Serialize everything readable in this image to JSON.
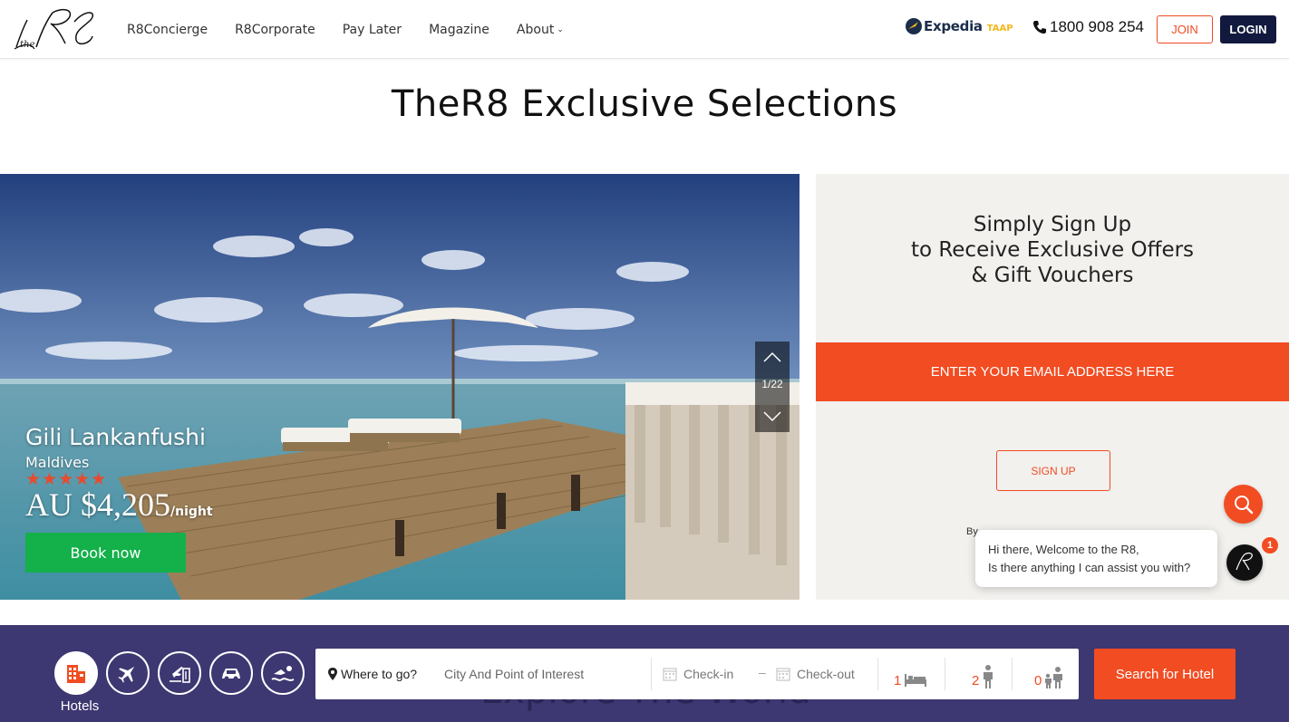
{
  "header": {
    "nav": [
      "R8Concierge",
      "R8Corporate",
      "Pay Later",
      "Magazine",
      "About"
    ],
    "expedia": {
      "name": "Expedia",
      "suffix": "TAAP"
    },
    "phone": "1800 908 254",
    "join_label": "JOIN",
    "login_label": "LOGIN"
  },
  "page_title": "TheR8 Exclusive Selections",
  "featured": {
    "hotel_name": "Gili Lankanfushi",
    "location": "Maldives",
    "stars": "★★★★★",
    "price": "AU $4,205",
    "price_unit": "/night",
    "book_label": "Book now",
    "slide_counter": "1/22"
  },
  "signup": {
    "title_lines": [
      "Simply Sign Up",
      "to Receive Exclusive Offers",
      "& Gift Vouchers"
    ],
    "email_placeholder": "ENTER YOUR EMAIL ADDRESS HERE",
    "button_label": "SIGN UP",
    "by_text": "By"
  },
  "chat": {
    "line1": "Hi there, Welcome to the R8,",
    "line2": "Is there anything I can assist you with?",
    "badge": "1"
  },
  "search": {
    "background_text": "Explore The World",
    "categories": [
      "hotel-icon",
      "flight-icon",
      "flight-hotel-icon",
      "car-icon",
      "activity-icon"
    ],
    "active_label": "Hotels",
    "where_label": "Where to go?",
    "destination_placeholder": "City And Point of Interest",
    "checkin_label": "Check-in",
    "checkout_label": "Check-out",
    "rooms": "1",
    "adults": "2",
    "children": "0",
    "button_label": "Search for Hotel"
  },
  "colors": {
    "brand_orange": "#f24c22",
    "navy": "#111a3e",
    "band_purple": "#3d3772",
    "book_green": "#14b04a"
  }
}
